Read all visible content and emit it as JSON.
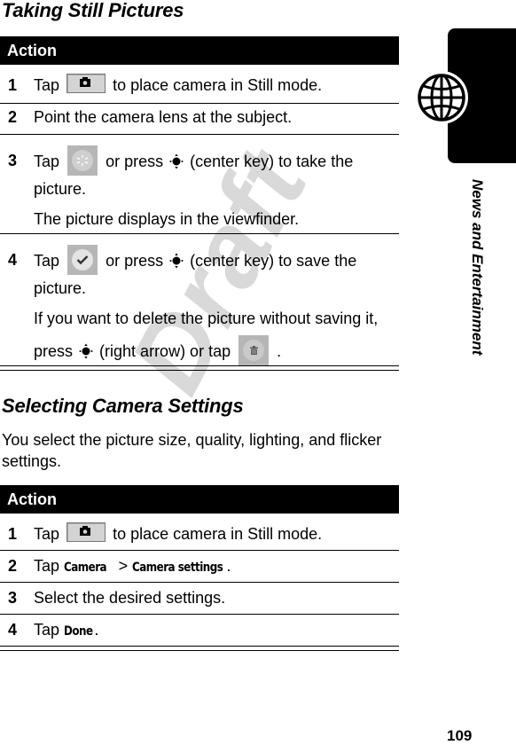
{
  "watermark": "Draft",
  "section1": {
    "title": "Taking Still Pictures",
    "table_header": "Action",
    "rows": [
      {
        "num": "1",
        "pre": "Tap",
        "icon": "camera-still-mode-icon",
        "post": "to place camera in Still mode."
      },
      {
        "num": "2",
        "text": "Point the camera lens at the subject."
      },
      {
        "num": "3",
        "pre": "Tap",
        "icon": "capture-shutter-icon",
        "mid1": "or press",
        "key_icon": "nav-center-key-icon",
        "post": "(center key) to take the picture.",
        "note": "The picture displays in the viewfinder."
      },
      {
        "num": "4",
        "pre": "Tap",
        "icon": "checkmark-save-icon",
        "mid1": "or press",
        "key_icon": "nav-center-key-icon",
        "post": "(center key) to save the picture.",
        "note_pre": "If you want to delete the picture without saving it,",
        "note_press": "press",
        "note_key": "(right arrow) or tap",
        "note_icon": "trash-delete-icon",
        "note_end": "."
      }
    ]
  },
  "section2": {
    "title": "Selecting Camera Settings",
    "intro": "You select the picture size, quality, lighting, and flicker settings.",
    "table_header": "Action",
    "rows": [
      {
        "num": "1",
        "pre": "Tap",
        "icon": "camera-still-mode-icon",
        "post": "to place camera in Still mode."
      },
      {
        "num": "2",
        "pre": "Tap",
        "cmd1": "Camera",
        "sep": ">",
        "cmd2": "Camera settings",
        "end": "."
      },
      {
        "num": "3",
        "text": "Select the desired settings."
      },
      {
        "num": "4",
        "pre": "Tap",
        "cmd1": "Done",
        "end": "."
      }
    ]
  },
  "sidebar": {
    "chapter_icon": "globe-icon",
    "chapter_label": "News and Entertainment"
  },
  "page_number": "109"
}
